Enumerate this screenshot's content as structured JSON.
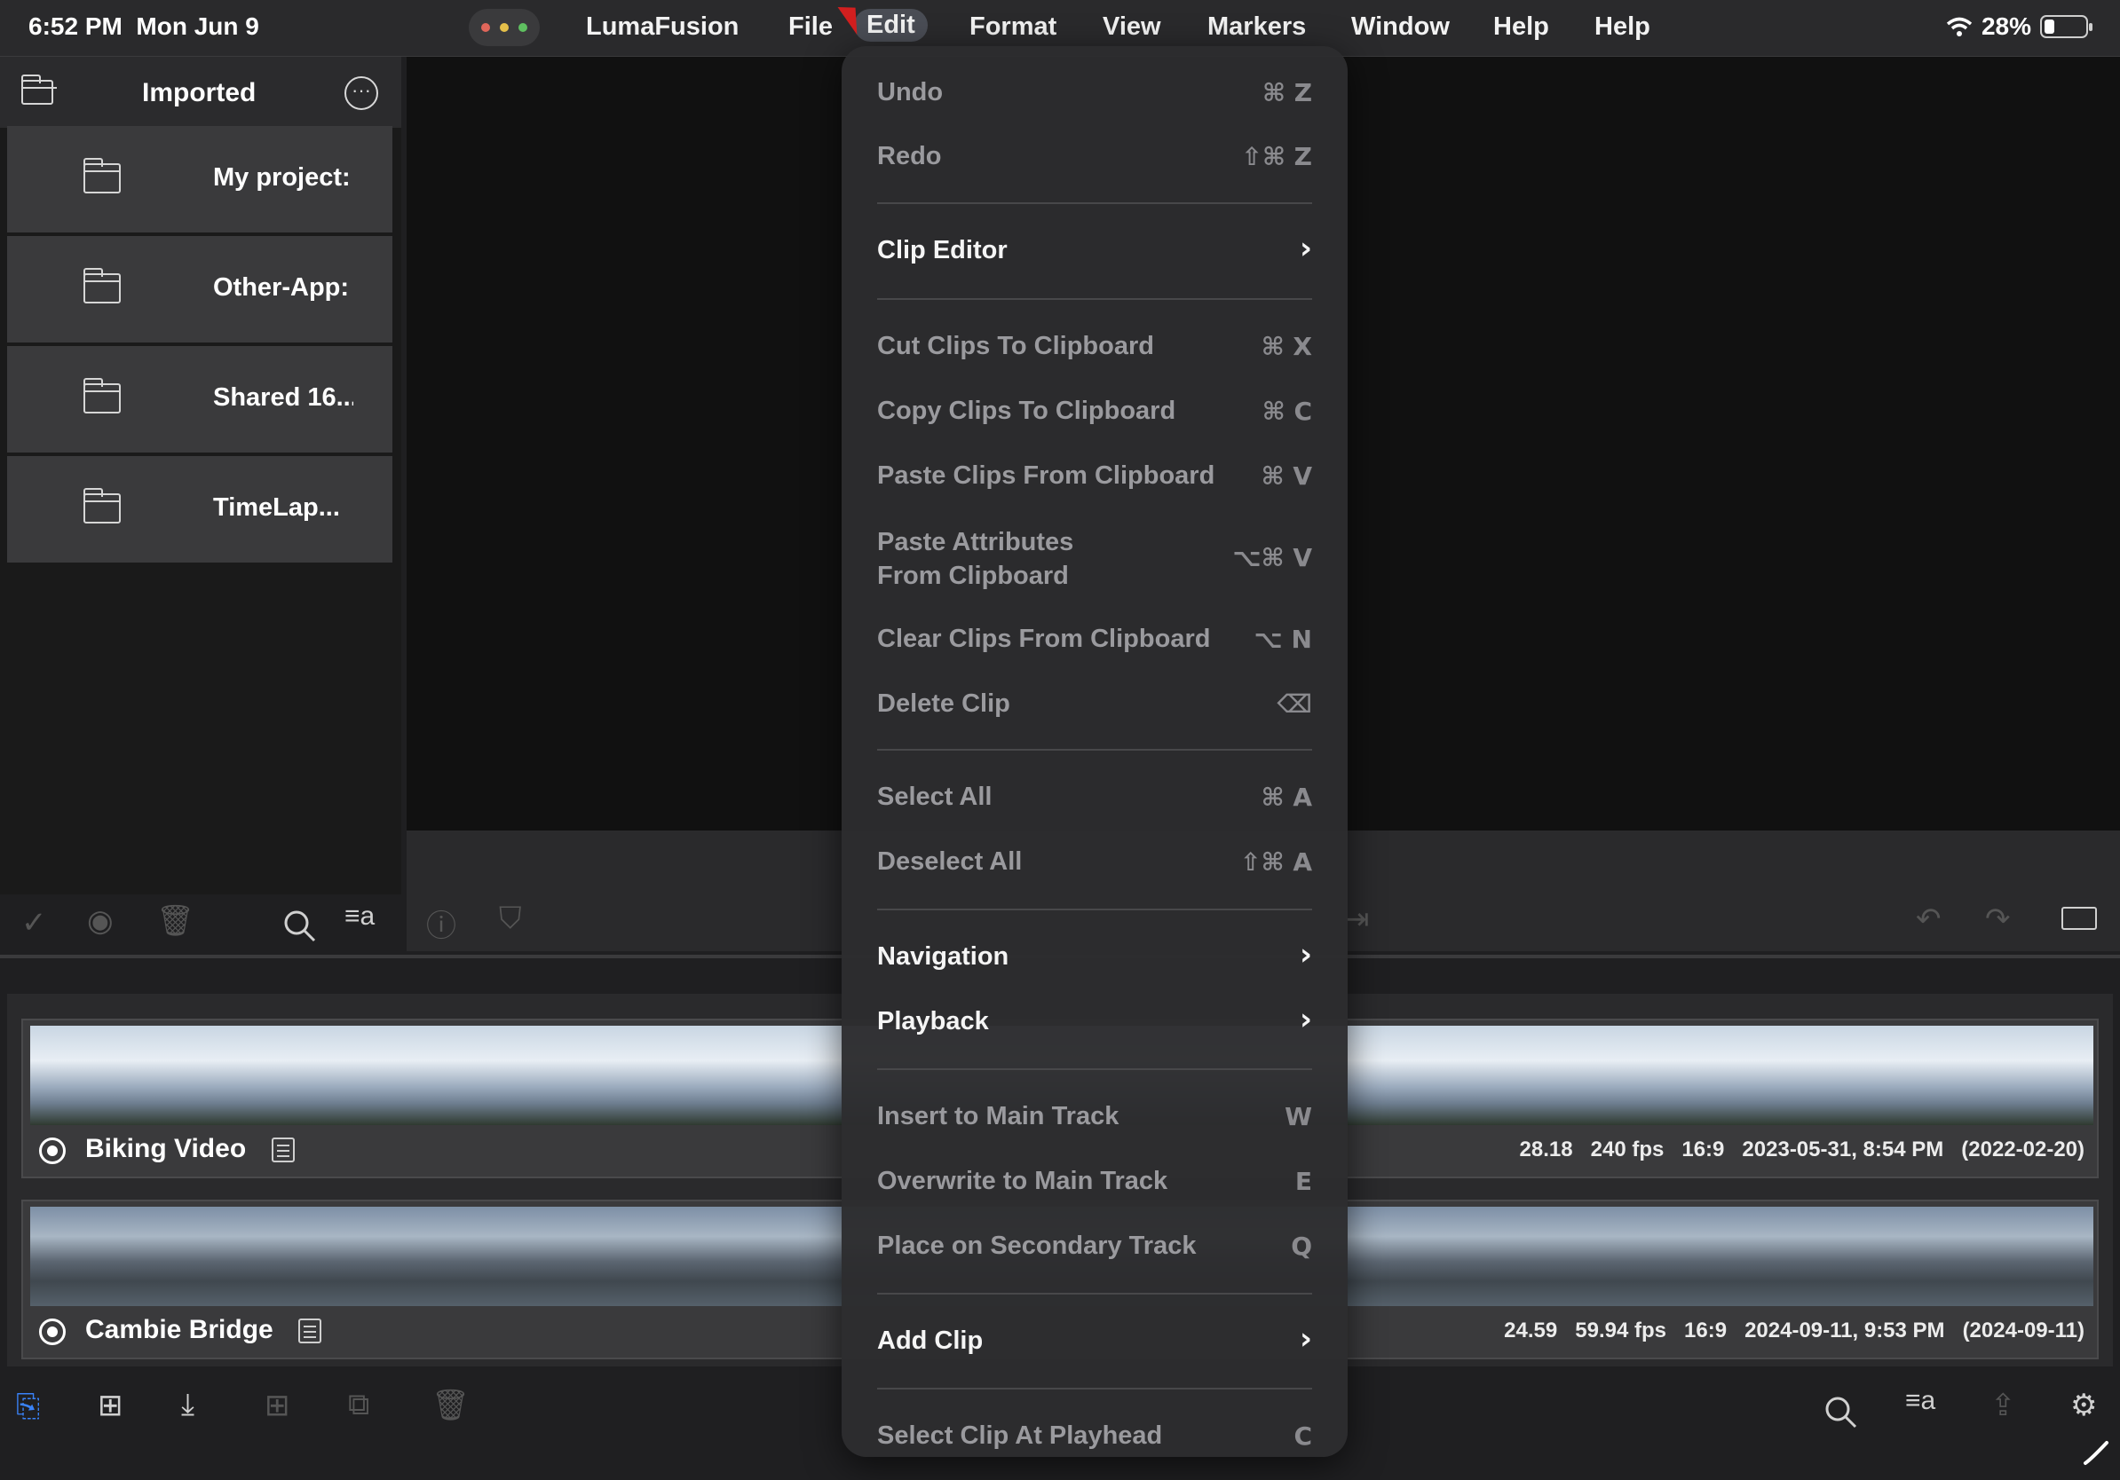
{
  "status": {
    "time": "6:52 PM",
    "date": "Mon Jun 9",
    "battery": "28%"
  },
  "menubar": {
    "app": "LumaFusion",
    "items": [
      "File",
      "Edit",
      "Format",
      "View",
      "Markers",
      "Window",
      "Help",
      "Help"
    ],
    "active": "Edit"
  },
  "library": {
    "title": "Imported",
    "folders": [
      {
        "name": "My project:"
      },
      {
        "name": "Other-App:"
      },
      {
        "name": "Shared 16..."
      },
      {
        "name": "TimeLap..."
      }
    ]
  },
  "edit_menu": {
    "items": [
      {
        "label": "Undo",
        "shortcut": "⌘ Z",
        "enabled": false
      },
      {
        "label": "Redo",
        "shortcut": "⇧⌘ Z",
        "enabled": false
      },
      {
        "label": "Clip Editor",
        "submenu": true,
        "enabled": true
      },
      {
        "label": "Cut Clips To Clipboard",
        "shortcut": "⌘ X",
        "enabled": false
      },
      {
        "label": "Copy Clips To Clipboard",
        "shortcut": "⌘ C",
        "enabled": false
      },
      {
        "label": "Paste Clips From Clipboard",
        "shortcut": "⌘ V",
        "enabled": false
      },
      {
        "label": "Paste Attributes",
        "label2": "From Clipboard",
        "shortcut": "⌥⌘ V",
        "enabled": false
      },
      {
        "label": "Clear Clips From Clipboard",
        "shortcut": "⌥ N",
        "enabled": false
      },
      {
        "label": "Delete Clip",
        "shortcut": "⌫",
        "enabled": false
      },
      {
        "label": "Select All",
        "shortcut": "⌘ A",
        "enabled": false
      },
      {
        "label": "Deselect All",
        "shortcut": "⇧⌘ A",
        "enabled": false
      },
      {
        "label": "Navigation",
        "submenu": true,
        "enabled": true
      },
      {
        "label": "Playback",
        "submenu": true,
        "enabled": true
      },
      {
        "label": "Insert to Main Track",
        "shortcut": "W",
        "enabled": false
      },
      {
        "label": "Overwrite to Main Track",
        "shortcut": "E",
        "enabled": false
      },
      {
        "label": "Place on Secondary Track",
        "shortcut": "Q",
        "enabled": false
      },
      {
        "label": "Add Clip",
        "submenu": true,
        "enabled": true
      },
      {
        "label": "Select Clip At Playhead",
        "shortcut": "C",
        "enabled": false
      }
    ]
  },
  "clips": [
    {
      "name": "Biking Video",
      "duration": "28.18",
      "fps": "240 fps",
      "aspect": "16:9",
      "date": "2023-05-31, 8:54 PM",
      "orig_date": "(2022-02-20)"
    },
    {
      "name": "Cambie Bridge",
      "duration": "24.59",
      "fps": "59.94 fps",
      "aspect": "16:9",
      "date": "2024-09-11, 9:53 PM",
      "orig_date": "(2024-09-11)"
    }
  ],
  "colors": {
    "accent": "#3a82f7",
    "menu_active": "#4a4d55",
    "cursor": "#d21f1f"
  },
  "icons": [
    "folder-icon",
    "more-icon",
    "checkmark-icon",
    "record-icon",
    "trash-icon",
    "search-icon",
    "sort-icon",
    "info-icon",
    "marker-icon",
    "undo-icon",
    "redo-icon",
    "settings-icon",
    "import-icon",
    "add-icon",
    "share-icon",
    "wifi-icon",
    "battery-icon"
  ]
}
